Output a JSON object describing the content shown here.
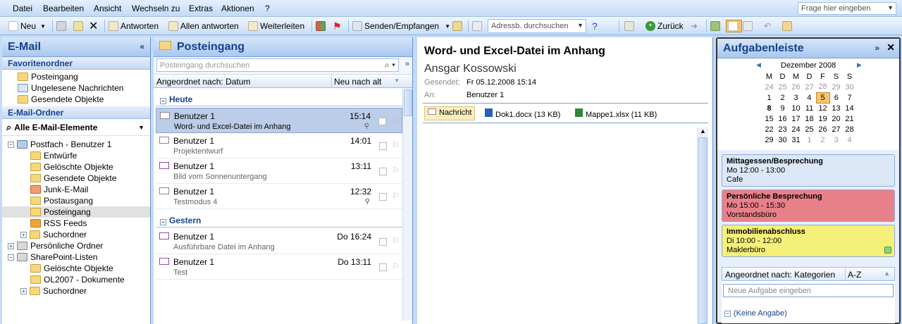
{
  "menu": [
    "Datei",
    "Bearbeiten",
    "Ansicht",
    "Wechseln zu",
    "Extras",
    "Aktionen",
    "?"
  ],
  "ask_placeholder": "Frage hier eingeben",
  "toolbar": {
    "new": "Neu",
    "reply": "Antworten",
    "reply_all": "Allen antworten",
    "forward": "Weiterleiten",
    "send_receive": "Senden/Empfangen",
    "addr_search": "Adressb. durchsuchen",
    "back": "Zurück"
  },
  "nav": {
    "title": "E-Mail",
    "fav_title": "Favoritenordner",
    "favorites": [
      "Posteingang",
      "Ungelesene Nachrichten",
      "Gesendete Objekte"
    ],
    "folders_title": "E-Mail-Ordner",
    "all_items": "Alle E-Mail-Elemente",
    "tree": [
      "Postfach - Benutzer 1",
      "Entwürfe",
      "Gelöschte Objekte",
      "Gesendete Objekte",
      "Junk-E-Mail",
      "Postausgang",
      "Posteingang",
      "RSS Feeds",
      "Suchordner",
      "Persönliche Ordner",
      "SharePoint-Listen",
      "Gelöschte Objekte",
      "OL2007 - Dokumente",
      "Suchordner"
    ]
  },
  "inbox": {
    "title": "Posteingang",
    "search_placeholder": "Posteingang durchsuchen",
    "arrange": "Angeordnet nach: Datum",
    "sort": "Neu nach alt",
    "groups": [
      "Heute",
      "Gestern"
    ],
    "mails": [
      {
        "from": "Benutzer 1",
        "subject": "Word- und Excel-Datei im Anhang",
        "time": "15:14"
      },
      {
        "from": "Benutzer 1",
        "subject": "Projektentwurf",
        "time": "14:01"
      },
      {
        "from": "Benutzer 1",
        "subject": "Bild vom Sonnenuntergang",
        "time": "13:11"
      },
      {
        "from": "Benutzer 1",
        "subject": "Testmodus 4",
        "time": "12:32"
      },
      {
        "from": "Benutzer 1",
        "subject": "Ausführbare Datei im Anhang",
        "time": "Do 16:24"
      },
      {
        "from": "Benutzer 1",
        "subject": "Test",
        "time": "Do 13:11"
      }
    ]
  },
  "reading": {
    "subject": "Word- und Excel-Datei im Anhang",
    "sender": "Ansgar Kossowski",
    "sent_label": "Gesendet:",
    "sent_value": "Fr 05.12.2008 15:14",
    "to_label": "An:",
    "to_value": "Benutzer 1",
    "tab_message": "Nachricht",
    "att1": "Dok1.docx (13 KB)",
    "att2": "Mappe1.xlsx (11 KB)"
  },
  "todo": {
    "title": "Aufgabenleiste",
    "month": "Dezember 2008",
    "weekdays": [
      "M",
      "D",
      "M",
      "D",
      "F",
      "S",
      "S"
    ],
    "appointments": [
      {
        "title": "Mittagessen/Besprechung",
        "time": "Mo 12:00 - 13:00",
        "place": "Cafe",
        "color": "#dce8f7"
      },
      {
        "title": "Persönliche Besprechung",
        "time": "Mo 15:00 - 15:30",
        "place": "Vorstandsbüro",
        "color": "#e8808a"
      },
      {
        "title": "Immobilienabschluss",
        "time": "Di 10:00 - 12:00",
        "place": "Maklerbüro",
        "color": "#f4f07a"
      }
    ],
    "tasks_arrange": "Angeordnet nach: Kategorien",
    "tasks_sort": "A-Z",
    "new_task_placeholder": "Neue Aufgabe eingeben",
    "no_category": "(Keine Angabe)"
  }
}
